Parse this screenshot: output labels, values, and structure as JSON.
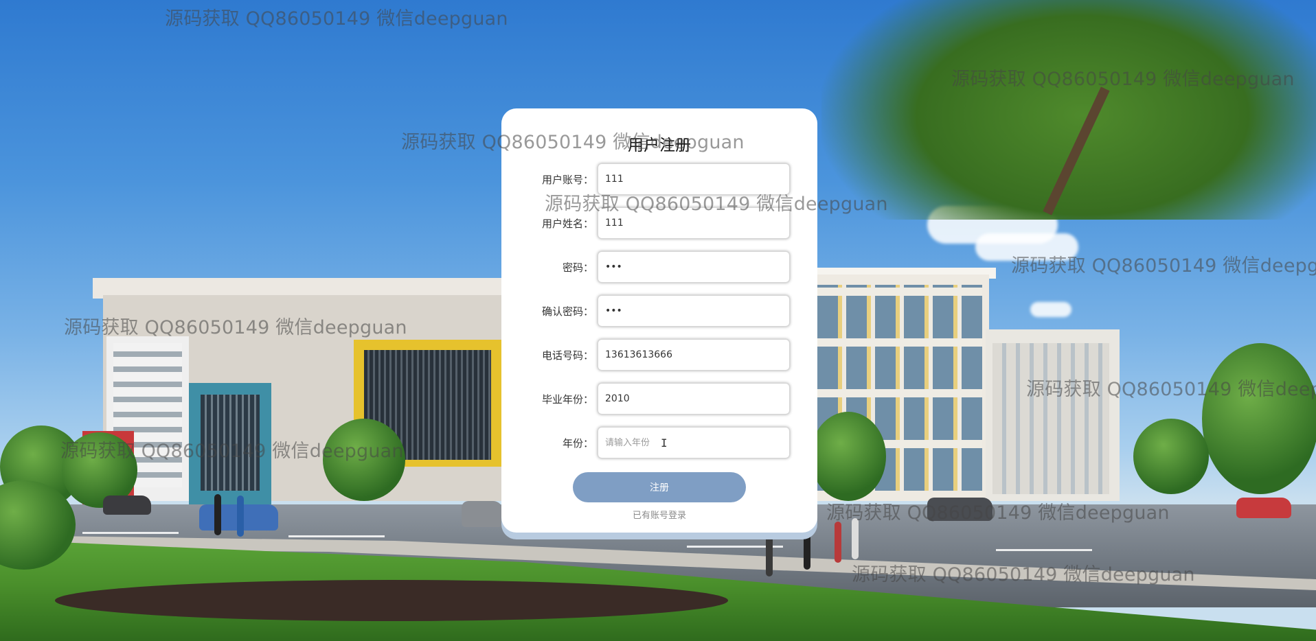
{
  "form": {
    "title": "用户注册",
    "fields": [
      {
        "label": "用户账号：",
        "value": "111",
        "placeholder": "",
        "type": "text"
      },
      {
        "label": "用户姓名：",
        "value": "111",
        "placeholder": "",
        "type": "text"
      },
      {
        "label": "密码：",
        "value": "111",
        "placeholder": "",
        "type": "password"
      },
      {
        "label": "确认密码：",
        "value": "111",
        "placeholder": "",
        "type": "password"
      },
      {
        "label": "电话号码：",
        "value": "13613613666",
        "placeholder": "",
        "type": "text"
      },
      {
        "label": "毕业年份：",
        "value": "2010",
        "placeholder": "",
        "type": "text"
      },
      {
        "label": "年份：",
        "value": "",
        "placeholder": "请输入年份",
        "type": "text"
      }
    ],
    "submit_label": "注册",
    "login_link": "已有账号登录"
  },
  "watermark": {
    "text": "源码获取 QQ86050149 微信deepguan"
  },
  "colors": {
    "submit_button": "#7f9ec4",
    "card_background": "#ffffff",
    "card_shadow": "#b8cbe0"
  },
  "background": {
    "description_icon": "campus-building-photo"
  }
}
